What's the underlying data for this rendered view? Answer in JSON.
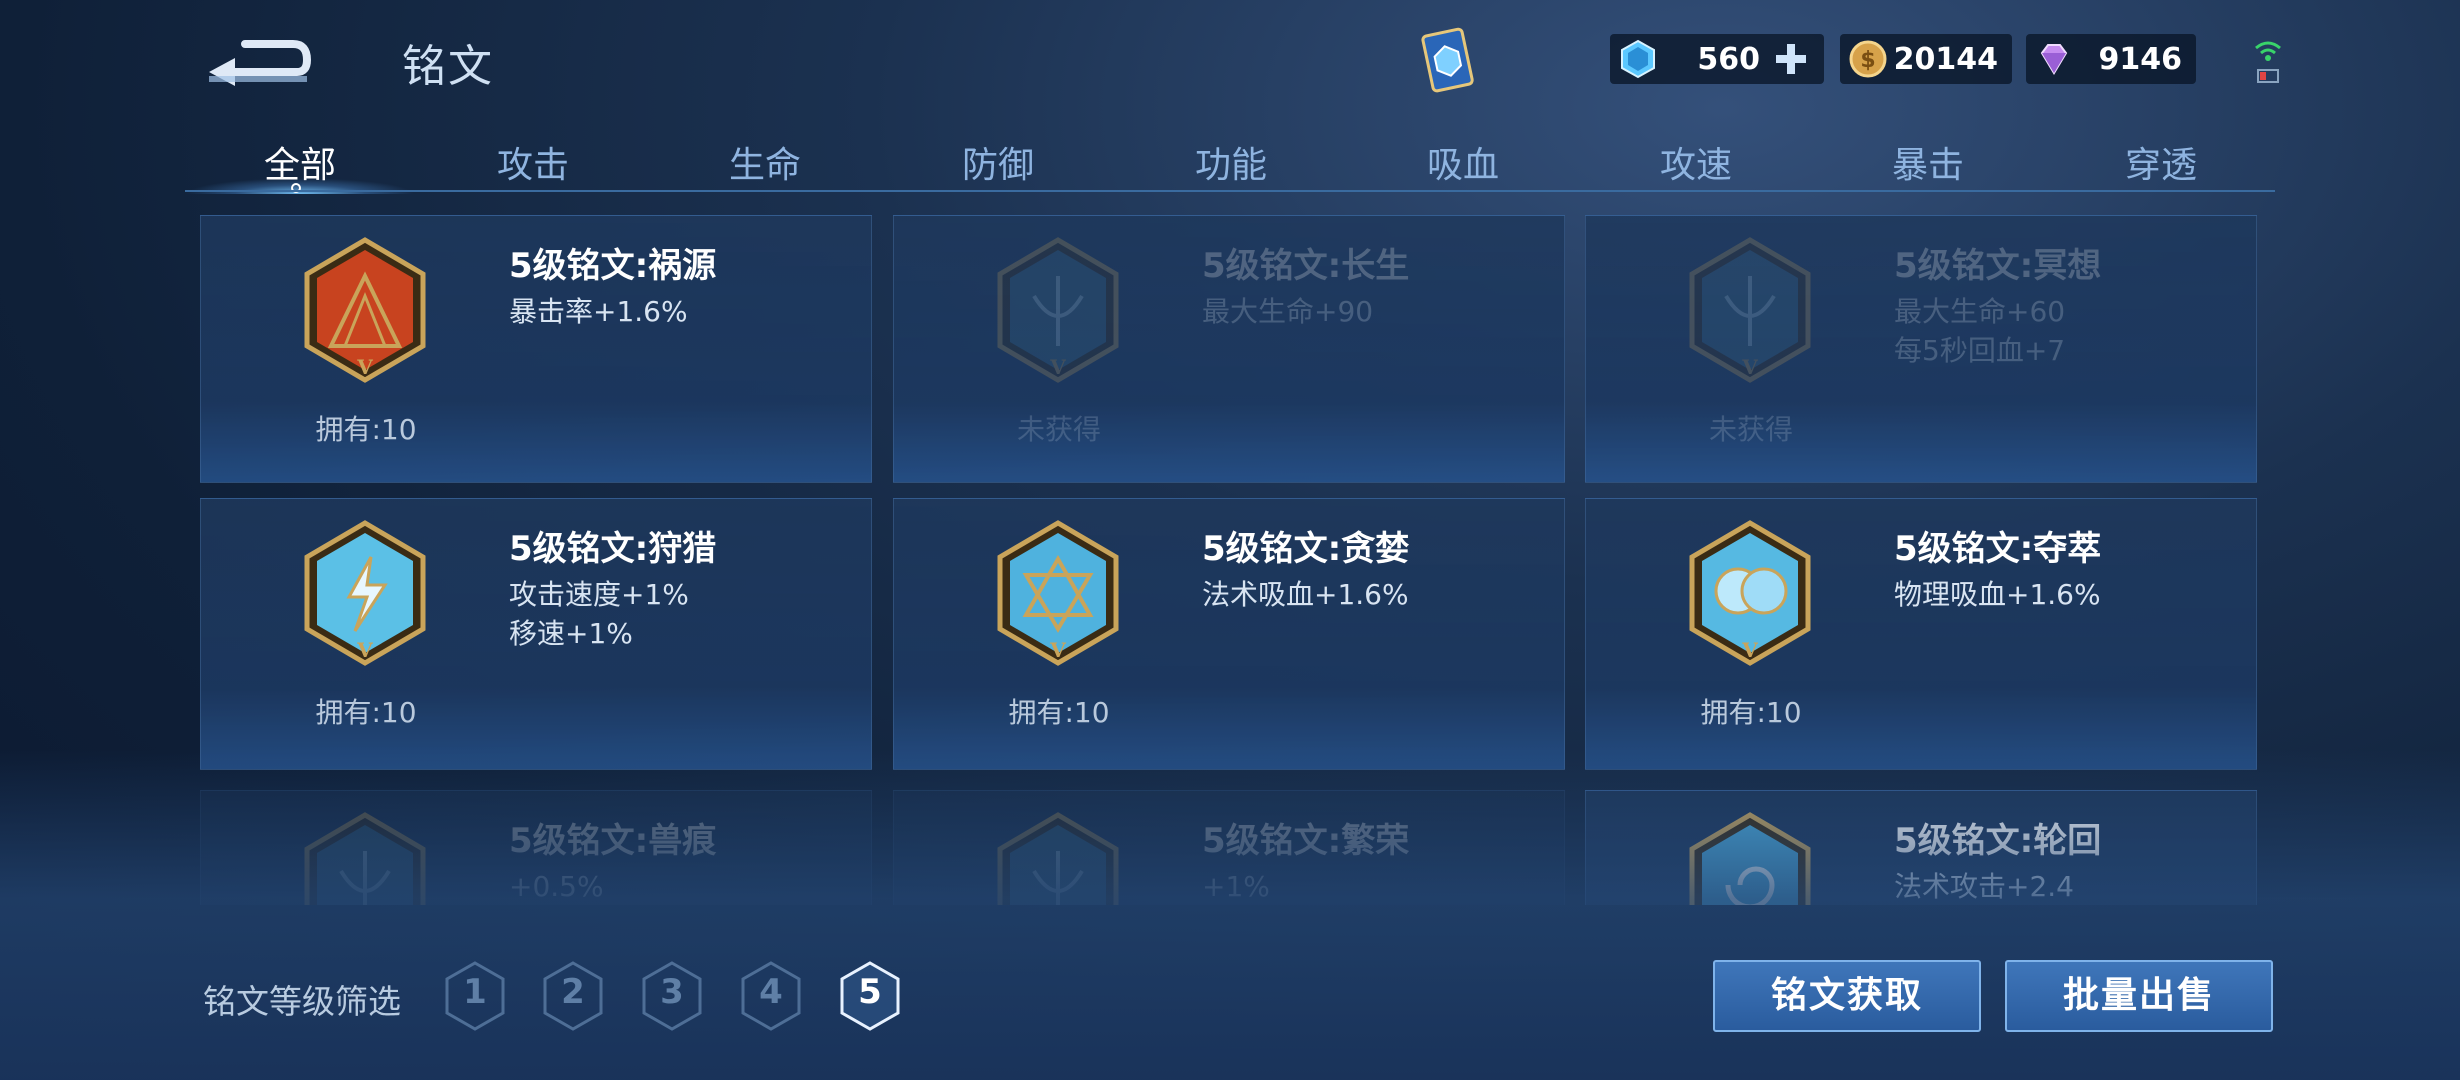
{
  "header": {
    "title": "铭文",
    "currencies": {
      "gem": "560",
      "gold": "20144",
      "diamond": "9146"
    }
  },
  "tabs": [
    {
      "label": "全部",
      "active": true
    },
    {
      "label": "攻击"
    },
    {
      "label": "生命"
    },
    {
      "label": "防御"
    },
    {
      "label": "功能"
    },
    {
      "label": "吸血"
    },
    {
      "label": "攻速"
    },
    {
      "label": "暴击"
    },
    {
      "label": "穿透"
    }
  ],
  "cards": [
    {
      "title": "5级铭文:祸源",
      "desc1": "暴击率+1.6%",
      "desc2": "",
      "owned": "拥有:10",
      "color": "#c8431f",
      "state": "owned"
    },
    {
      "title": "5级铭文:长生",
      "desc1": "最大生命+90",
      "desc2": "",
      "owned": "未获得",
      "color": "#3d6f8e",
      "state": "unowned"
    },
    {
      "title": "5级铭文:冥想",
      "desc1": "最大生命+60",
      "desc2": "每5秒回血+7",
      "owned": "未获得",
      "color": "#3d6f8e",
      "state": "unowned"
    },
    {
      "title": "5级铭文:狩猎",
      "desc1": "攻击速度+1%",
      "desc2": "移速+1%",
      "owned": "拥有:10",
      "color": "#5bc0e6",
      "state": "owned"
    },
    {
      "title": "5级铭文:贪婪",
      "desc1": "法术吸血+1.6%",
      "desc2": "",
      "owned": "拥有:10",
      "color": "#4fb2de",
      "state": "owned"
    },
    {
      "title": "5级铭文:夺萃",
      "desc1": "物理吸血+1.6%",
      "desc2": "",
      "owned": "拥有:10",
      "color": "#56b9e2",
      "state": "owned"
    },
    {
      "title": "5级铭文:兽痕",
      "desc1": "+0.5%",
      "desc2": "",
      "owned": "",
      "color": "#3d6f8e",
      "state": "faded"
    },
    {
      "title": "5级铭文:繁荣",
      "desc1": "+1%",
      "desc2": "",
      "owned": "",
      "color": "#3d6f8e",
      "state": "faded"
    },
    {
      "title": "5级铭文:轮回",
      "desc1": "法术攻击+2.4",
      "desc2": "",
      "owned": "",
      "color": "#4aa8d8",
      "state": "partial"
    }
  ],
  "filter": {
    "label": "铭文等级筛选",
    "levels": [
      "1",
      "2",
      "3",
      "4",
      "5"
    ],
    "active_level": "5"
  },
  "actions": {
    "obtain": "铭文获取",
    "bulk_sell": "批量出售"
  },
  "colors": {
    "accent": "#3f76ba",
    "gold_frame": "#c9a45a"
  }
}
